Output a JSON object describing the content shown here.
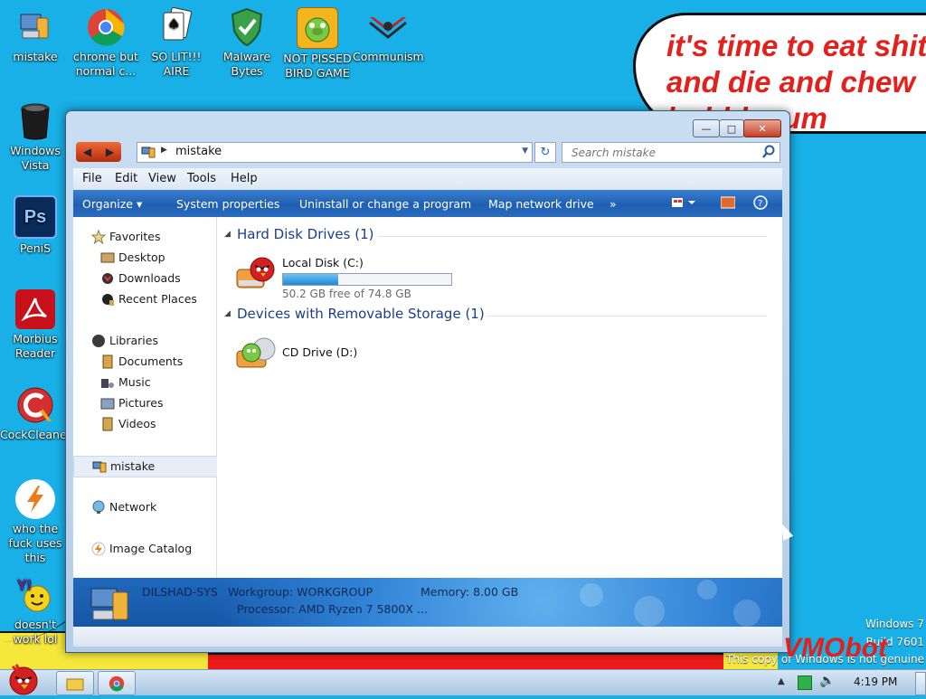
{
  "speech_bubble": {
    "line1": "it's time to eat shit",
    "line2": "and die and chew",
    "line3": "bubblegum"
  },
  "desktop_icons": [
    {
      "label": "mistake",
      "icon": "computer-icon"
    },
    {
      "label": "chrome but normal c...",
      "icon": "chrome-icon"
    },
    {
      "label": "SO LIT!!! AIRE",
      "icon": "solitaire-icon"
    },
    {
      "label": "Malware Bytes",
      "icon": "shield-icon"
    },
    {
      "label": "NOT PISSED BIRD GAME",
      "icon": "pig-icon"
    },
    {
      "label": "Communism",
      "icon": "hammer-sickle-icon"
    },
    {
      "label": "Windows Vista",
      "icon": "trash-icon"
    },
    {
      "label": "PeniS",
      "icon": "photoshop-icon"
    },
    {
      "label": "Morbius Reader",
      "icon": "pdf-icon"
    },
    {
      "label": "CockCleaner",
      "icon": "ccleaner-icon"
    },
    {
      "label": "who the fuck uses this",
      "icon": "bolt-icon"
    },
    {
      "label": "doesn't work lol",
      "icon": "yahoo-icon"
    }
  ],
  "window": {
    "address": "mistake",
    "search_placeholder": "Search mistake",
    "controls": {
      "min": "—",
      "max": "□",
      "close": "✕"
    }
  },
  "menu": [
    "File",
    "Edit",
    "View",
    "Tools",
    "Help"
  ],
  "commands": [
    "Organize ▾",
    "System properties",
    "Uninstall or change a program",
    "Map network drive",
    "»"
  ],
  "nav": {
    "favorites": "Favorites",
    "desktop": "Desktop",
    "downloads": "Downloads",
    "recent": "Recent Places",
    "libraries": "Libraries",
    "documents": "Documents",
    "music": "Music",
    "pictures": "Pictures",
    "videos": "Videos",
    "computer": "mistake",
    "network": "Network",
    "catalog": "Image Catalog"
  },
  "groups": {
    "hdd": "Hard Disk Drives (1)",
    "removable": "Devices with Removable Storage (1)"
  },
  "drives": {
    "c": {
      "name": "Local Disk (C:)",
      "free": "50.2 GB free of 74.8 GB",
      "used_fraction": 0.33
    },
    "d": {
      "name": "CD Drive (D:)"
    }
  },
  "details": {
    "name": "DILSHAD-SYS",
    "workgroup": "Workgroup: WORKGROUP",
    "memory": "Memory: 8.00 GB",
    "processor": "Processor: AMD Ryzen 7 5800X ..."
  },
  "taskbar": {
    "time": "4:19 PM"
  },
  "watermark": {
    "line1": "Windows 7",
    "line2": "Build 7601",
    "line3": "This copy of Windows is not genuine",
    "brand": "VMObot"
  }
}
